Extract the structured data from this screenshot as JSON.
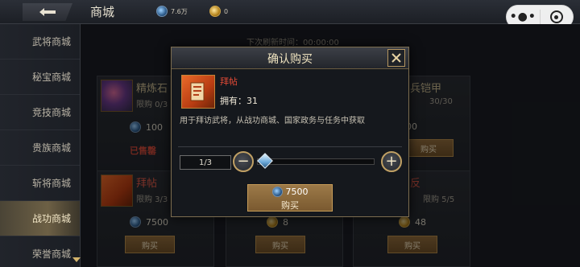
{
  "header": {
    "title": "商城",
    "res_blue": "7.6万",
    "res_gold": "0"
  },
  "sidebar": {
    "items": [
      {
        "label": "武将商城",
        "active": false
      },
      {
        "label": "秘宝商城",
        "active": false
      },
      {
        "label": "竞技商城",
        "active": false
      },
      {
        "label": "贵族商城",
        "active": false
      },
      {
        "label": "斩将商城",
        "active": false
      },
      {
        "label": "战功商城",
        "active": true
      },
      {
        "label": "荣誉商城",
        "active": false
      }
    ]
  },
  "refresh": "下次刷新时间：00:00:00",
  "cards": [
    {
      "name": "精炼石",
      "limit": "限购 0/3",
      "price": "100",
      "status": "已售罄"
    },
    {
      "name": "兵铠甲",
      "limit": "30/30",
      "price": "300",
      "buy": "购买"
    },
    {
      "name": "拜帖",
      "limit": "限购 3/3",
      "price": "7500",
      "buy": "购买"
    },
    {
      "name": "",
      "limit": "",
      "price": "8",
      "buy": "购买"
    },
    {
      "name": "反",
      "limit": "限购 5/5",
      "price": "48",
      "buy": "购买"
    }
  ],
  "modal": {
    "title": "确认购买",
    "item_name": "拜帖",
    "owned_label": "拥有：",
    "owned_value": "31",
    "description": "用于拜访武将，从战功商城、国家政务与任务中获取",
    "quantity": "1/3",
    "cost": "7500",
    "buy_label": "购买"
  },
  "colors": {
    "accent_gold": "#c79c58",
    "item_red": "#e24a36",
    "sold_red": "#d04a3a"
  }
}
